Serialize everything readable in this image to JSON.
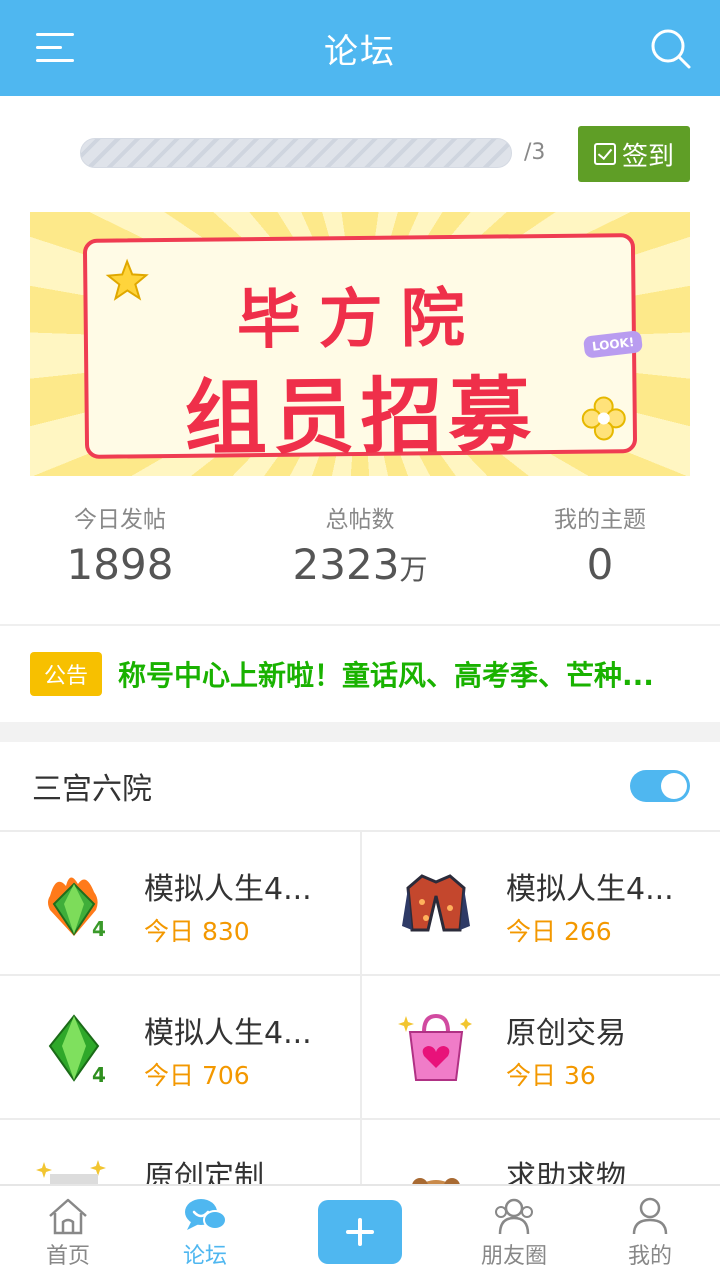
{
  "header": {
    "title": "论坛"
  },
  "checkin": {
    "progress_fraction": 0.0,
    "total": "/3",
    "button_label": "签到"
  },
  "banner": {
    "line1": "毕方院",
    "line2": "组员招募",
    "tag": "LOOK!"
  },
  "stats": [
    {
      "label": "今日发帖",
      "value": "1898",
      "unit": ""
    },
    {
      "label": "总帖数",
      "value": "2323",
      "unit": "万"
    },
    {
      "label": "我的主题",
      "value": "0",
      "unit": ""
    }
  ],
  "notice": {
    "badge": "公告",
    "text": "称号中心上新啦！童话风、高考季、芒种..."
  },
  "section": {
    "title": "三宫六院",
    "toggle_on": true
  },
  "forums": [
    {
      "name": "模拟人生4...",
      "today": "今日 830",
      "icon": "fire-crystal-4-icon"
    },
    {
      "name": "模拟人生4...",
      "today": "今日 266",
      "icon": "jacket-icon"
    },
    {
      "name": "模拟人生4...",
      "today": "今日 706",
      "icon": "green-crystal-4-icon"
    },
    {
      "name": "原创交易",
      "today": "今日 36",
      "icon": "shopping-bag-icon"
    },
    {
      "name": "原创定制",
      "today": "",
      "icon": "gift-icon"
    },
    {
      "name": "求助求物",
      "today": "",
      "icon": "hamster-icon"
    }
  ],
  "nav": [
    {
      "label": "首页",
      "icon": "home-icon"
    },
    {
      "label": "论坛",
      "icon": "forum-icon",
      "active": true
    },
    {
      "label": "",
      "icon": "plus-icon"
    },
    {
      "label": "朋友圈",
      "icon": "friends-icon"
    },
    {
      "label": "我的",
      "icon": "profile-icon"
    }
  ],
  "colors": {
    "brand": "#4fb7f0",
    "checkin": "#5f9e26",
    "notice_badge": "#f7c000",
    "notice_text": "#19b200",
    "today_count": "#f39800"
  }
}
